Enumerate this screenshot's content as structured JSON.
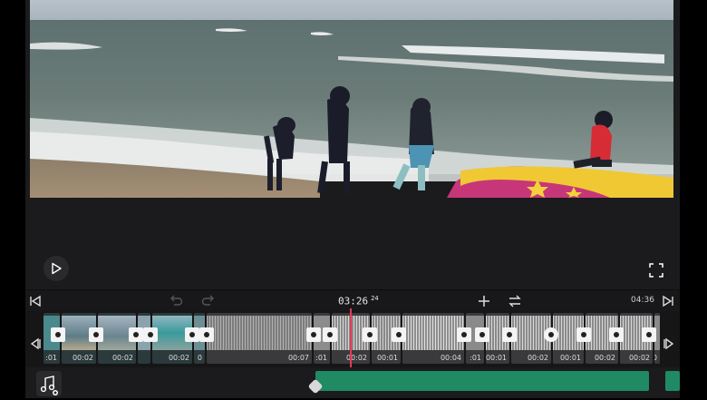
{
  "preview": {
    "scene": "beach-video-frame"
  },
  "toolbar": {
    "timecode": "03:26",
    "frames": "24",
    "duration": "04:36"
  },
  "timeline": {
    "clips": [
      {
        "dur": ":01"
      },
      {
        "dur": "00:02"
      },
      {
        "dur": "00:02"
      },
      {
        "dur": "00:02"
      },
      {
        "dur": "0"
      },
      {
        "dur": "00:07"
      },
      {
        "dur": ":01"
      },
      {
        "dur": "00:02"
      },
      {
        "dur": "00:01"
      },
      {
        "dur": "00:04"
      },
      {
        "dur": ":01"
      },
      {
        "dur": "00:01"
      },
      {
        "dur": "00:02"
      },
      {
        "dur": "00:01"
      },
      {
        "dur": "00:02"
      },
      {
        "dur": "00:02"
      },
      {
        "dur": ":0"
      }
    ]
  },
  "colors": {
    "accent_playhead": "#e5395a",
    "audio_clip": "#1f8a63",
    "background": "#1b1b1d"
  }
}
